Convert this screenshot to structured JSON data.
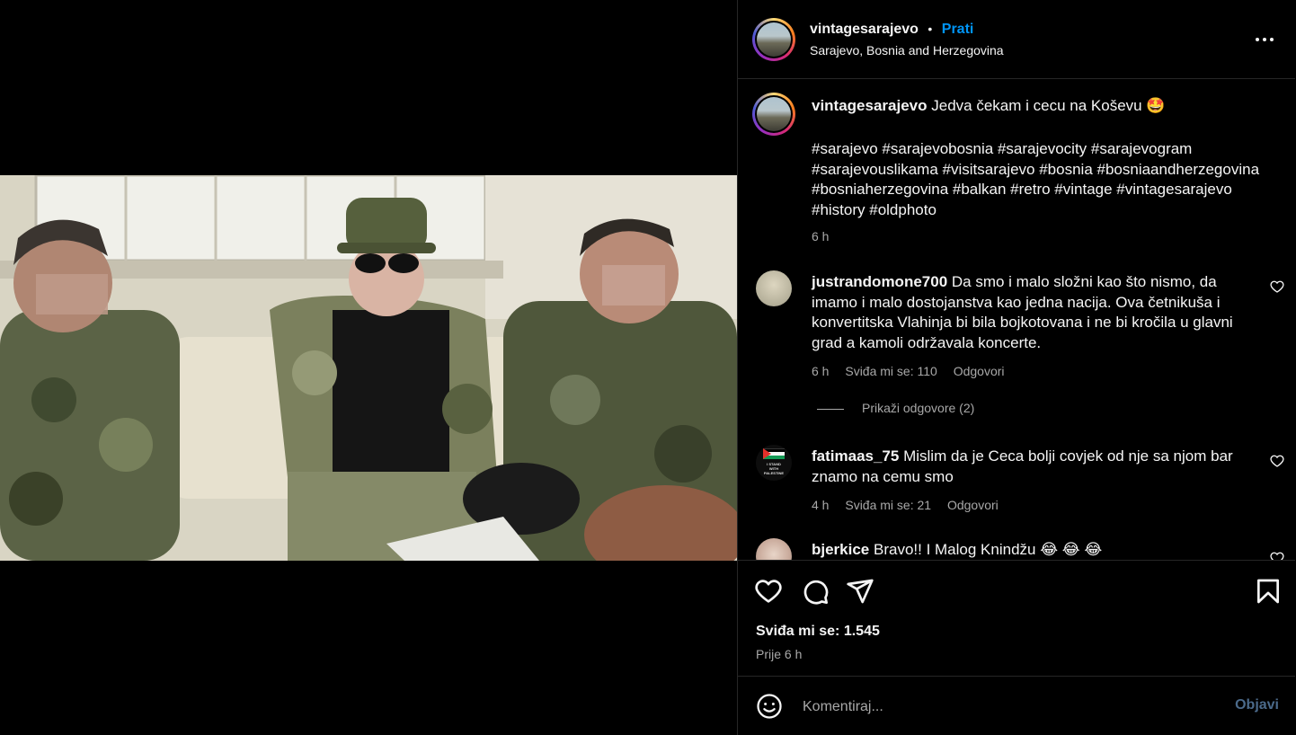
{
  "post_header": {
    "username": "vintagesarajevo",
    "separator": "•",
    "follow_label": "Prati",
    "location": "Sarajevo, Bosnia and Herzegovina"
  },
  "caption": {
    "username": "vintagesarajevo",
    "text": "Jedva čekam i cecu na Koševu 🤩",
    "hashtags": "#sarajevo #sarajevobosnia #sarajevocity #sarajevogram #sarajevouslikama #visitsarajevo #bosnia #bosniaandherzegovina #bosniaherzegovina #balkan #retro #vintage #vintagesarajevo #history #oldphoto",
    "time": "6 h"
  },
  "comments": [
    {
      "username": "justrandomone700",
      "text": "Da smo i malo složni kao što nismo, da imamo i malo dostojanstva kao jedna nacija. Ova četnikuša i konvertitska Vlahinja bi bila bojkotovana i ne bi kročila u glavni grad a kamoli održavala koncerte.",
      "time": "6 h",
      "likes": "Sviđa mi se: 110",
      "reply": "Odgovori"
    },
    {
      "username": "fatimaas_75",
      "text": "Mislim da je Ceca bolji covjek od nje sa njom bar znamo na cemu smo",
      "time": "4 h",
      "likes": "Sviđa mi se: 21",
      "reply": "Odgovori",
      "avatar_text": [
        "I STAND",
        "WITH",
        "PALESTINE"
      ]
    },
    {
      "username": "bjerkice",
      "text": "Bravo!! I Malog Knindžu 😂 😂 😂"
    }
  ],
  "view_replies": "Prikaži odgovore (2)",
  "actions": {
    "likes": "Sviđa mi se: 1.545",
    "time": "Prije 6 h"
  },
  "composer": {
    "placeholder": "Komentiraj...",
    "post_label": "Objavi"
  },
  "colors": {
    "accent": "#0095f6",
    "background": "#000000",
    "muted_text": "#a8a8a8"
  }
}
